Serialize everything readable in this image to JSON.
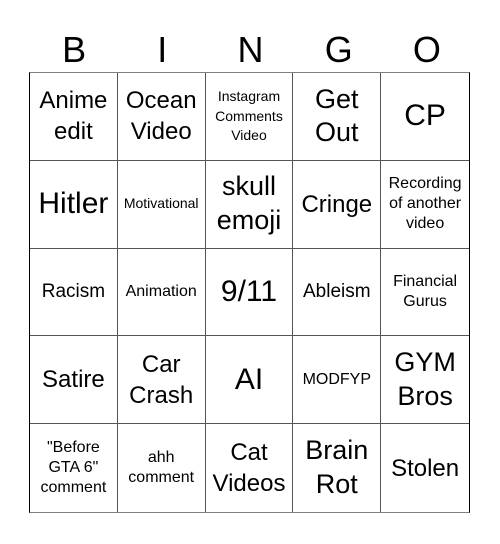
{
  "header": [
    "B",
    "I",
    "N",
    "G",
    "O"
  ],
  "cells": [
    [
      "Anime edit",
      "Ocean Video",
      "Instagram Comments Video",
      "Get Out",
      "CP"
    ],
    [
      "Hitler",
      "Motivational",
      "skull emoji",
      "Cringe",
      "Recording of another video"
    ],
    [
      "Racism",
      "Animation",
      "9/11",
      "Ableism",
      "Financial Gurus"
    ],
    [
      "Satire",
      "Car Crash",
      "AI",
      "MODFYP",
      "GYM Bros"
    ],
    [
      "\"Before GTA 6\" comment",
      "ahh comment",
      "Cat Videos",
      "Brain Rot",
      "Stolen"
    ]
  ]
}
